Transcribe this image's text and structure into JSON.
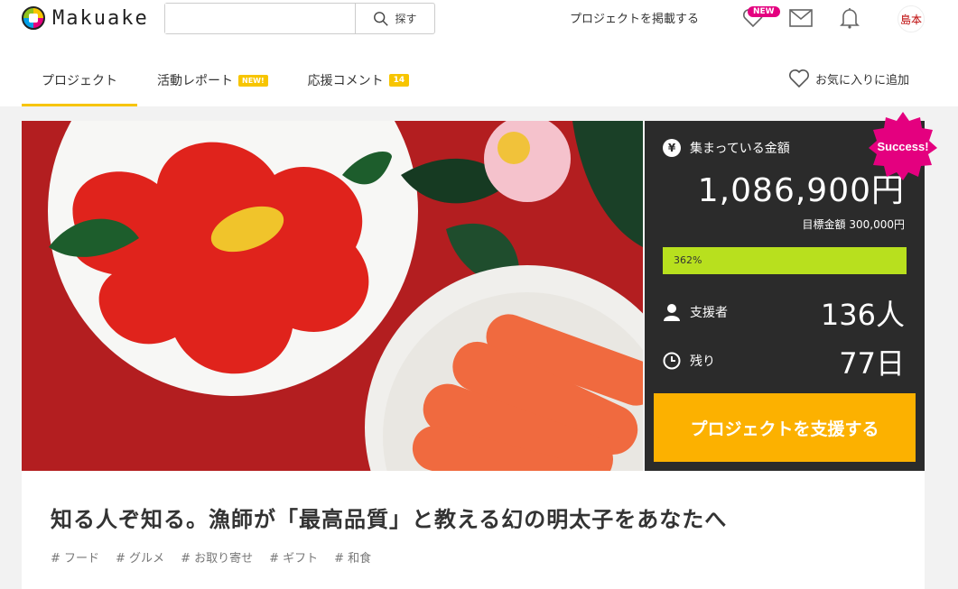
{
  "header": {
    "logo_text": "Makuake",
    "search_placeholder": "",
    "search_button": "探す",
    "post_project": "プロジェクトを掲載する",
    "new_badge": "NEW",
    "avatar_text": "島本"
  },
  "tabs": [
    {
      "label": "プロジェクト",
      "badge": ""
    },
    {
      "label": "活動レポート",
      "badge": "NEW!"
    },
    {
      "label": "応援コメント",
      "badge": "14"
    }
  ],
  "favorite": "お気に入りに追加",
  "stats": {
    "money_label": "集まっている金額",
    "yen_symbol": "¥",
    "amount": "1,086,900円",
    "target": "目標金額 300,000円",
    "progress_text": "362%",
    "progress_percent": 362,
    "supporters_label": "支援者",
    "supporters_value": "136人",
    "remaining_label": "残り",
    "remaining_value": "77日",
    "support_button": "プロジェクトを支援する",
    "success": "Success!"
  },
  "project": {
    "title": "知る人ぞ知る。漁師が「最高品質」と教える幻の明太子をあなたへ",
    "tags": [
      "# フード",
      "# グルメ",
      "# お取り寄せ",
      "# ギフト",
      "# 和食"
    ]
  },
  "colors": {
    "accent": "#f7c500",
    "support_button": "#fcb100",
    "progress": "#b8e01e",
    "panel": "#2b2b2b",
    "success_badge": "#e4007f"
  }
}
